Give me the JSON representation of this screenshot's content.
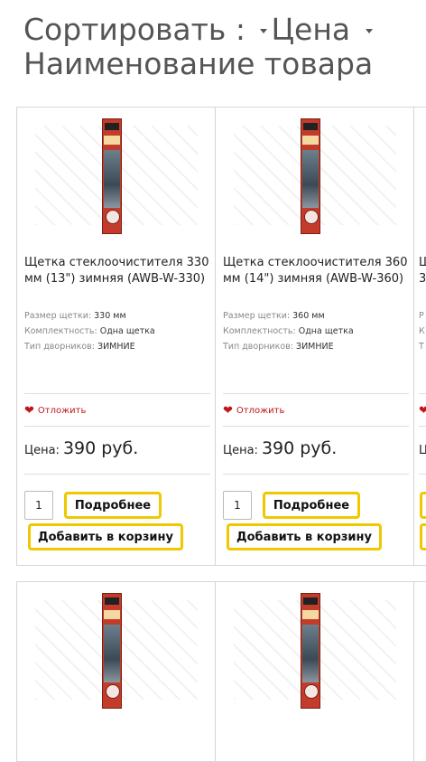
{
  "sort": {
    "label": "Сортировать :",
    "options": [
      "Цена",
      "Наименование товара"
    ]
  },
  "products": [
    {
      "title": "Щетка стеклоочистителя 330 мм (13\") зимняя (AWB-W-330)",
      "props": [
        {
          "name": "Размер щетки:",
          "value": "330 мм"
        },
        {
          "name": "Комплектность:",
          "value": "Одна щетка"
        },
        {
          "name": "Тип дворников:",
          "value": "ЗИМНИЕ"
        }
      ],
      "wishlist": "Отложить",
      "price_label": "Цена:",
      "price": "390 руб.",
      "qty": "1",
      "more_label": "Подробнее",
      "cart_label": "Добавить в корзину"
    },
    {
      "title": "Щетка стеклоочистителя 360 мм (14\") зимняя (AWB-W-360)",
      "props": [
        {
          "name": "Размер щетки:",
          "value": "360 мм"
        },
        {
          "name": "Комплектность:",
          "value": "Одна щетка"
        },
        {
          "name": "Тип дворников:",
          "value": "ЗИМНИЕ"
        }
      ],
      "wishlist": "Отложить",
      "price_label": "Цена:",
      "price": "390 руб.",
      "qty": "1",
      "more_label": "Подробнее",
      "cart_label": "Добавить в корзину"
    },
    {
      "title": "Щ 3",
      "props": [
        {
          "name": "Р",
          "value": ""
        },
        {
          "name": "К",
          "value": ""
        },
        {
          "name": "Т",
          "value": ""
        }
      ],
      "wishlist": "",
      "price_label": "Ц",
      "price": "",
      "qty": "",
      "more_label": "",
      "cart_label": ""
    }
  ],
  "colors": {
    "accent_border": "#f0c800",
    "wishlist": "#c0161b",
    "package": "#c33c2b"
  }
}
